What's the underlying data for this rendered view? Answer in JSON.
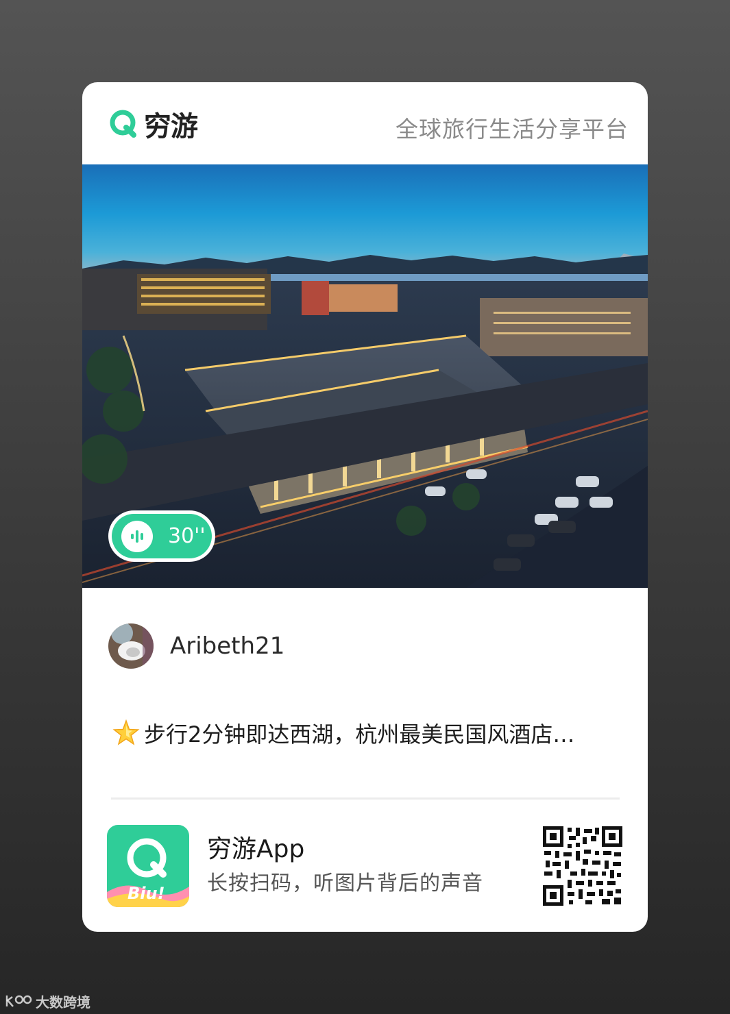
{
  "header": {
    "brand_name": "穷游",
    "tagline": "全球旅行生活分享平台"
  },
  "photo": {
    "subject": "hotel-photo",
    "audio_duration": "30''"
  },
  "user": {
    "username": "Aribeth21"
  },
  "post": {
    "emoji_icon": "star-emoji-icon",
    "title": "步行2分钟即达西湖，杭州最美民国风酒店…"
  },
  "footer": {
    "app_name": "穷游App",
    "app_icon_label": "Biu!",
    "description": "长按扫码，听图片背后的声音"
  },
  "watermark": {
    "text": "大数跨境"
  },
  "colors": {
    "brand_green": "#2fcd98",
    "card_bg": "#ffffff",
    "page_bg": "#3e3e3e"
  }
}
